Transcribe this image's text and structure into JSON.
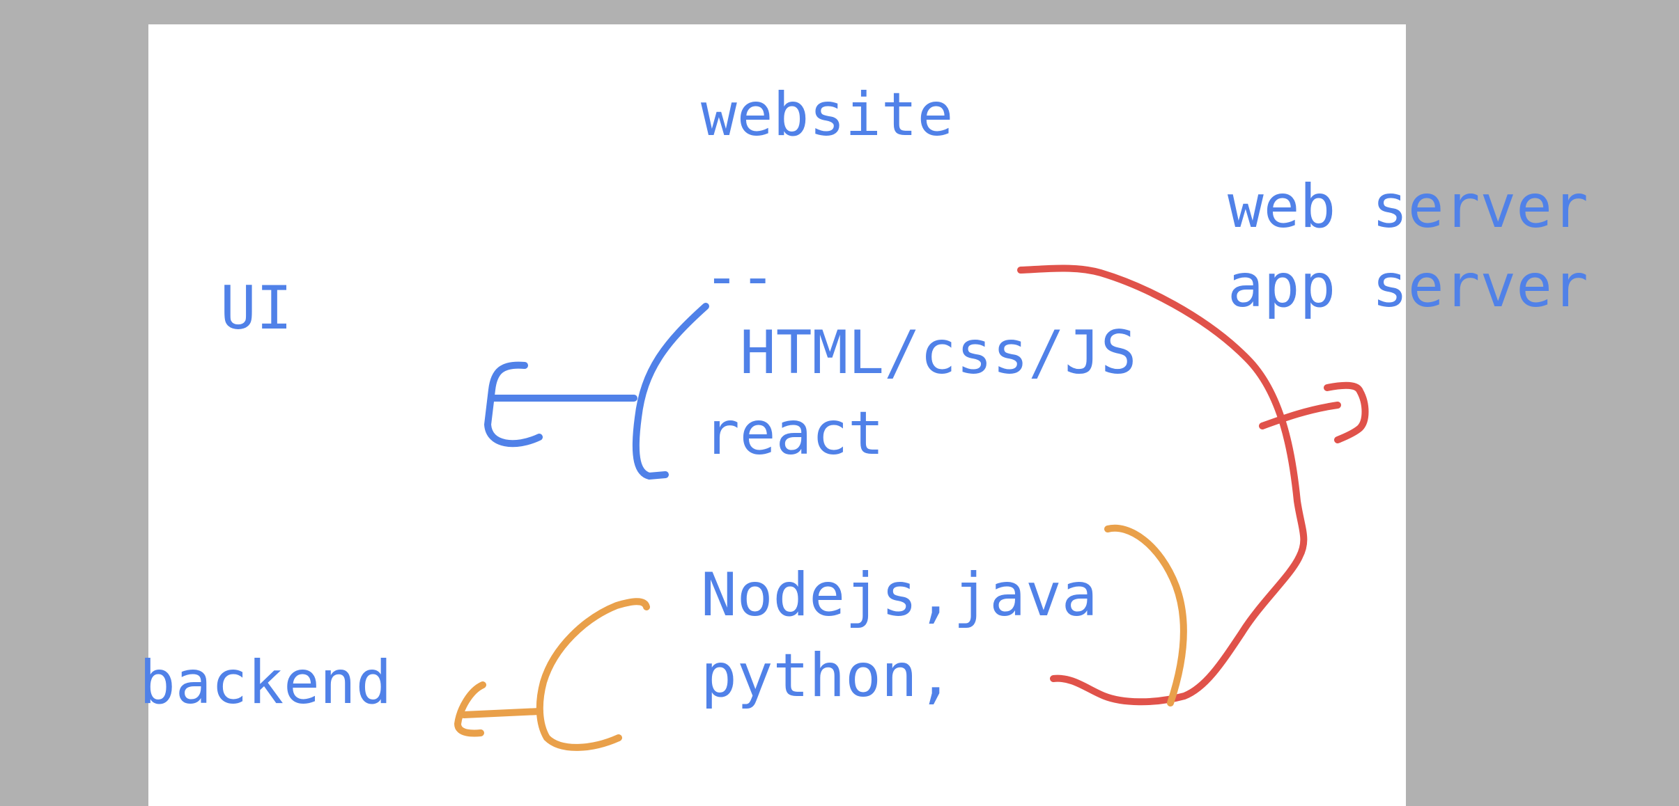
{
  "canvas": {
    "background": "#b1b1b1",
    "page_color": "#ffffff"
  },
  "colors": {
    "text": "#5081e8",
    "blue_stroke": "#5081e8",
    "red_stroke": "#e0524a",
    "orange_stroke": "#e9a04a"
  },
  "notes": {
    "title": "website",
    "ui_label": "UI",
    "dashes": "--",
    "frontend_line1": "HTML/css/JS",
    "frontend_line2": "react",
    "server_line1": "web server",
    "server_line2": "app server",
    "backend_line1": "Nodejs,java",
    "backend_line2": "python,",
    "backend_label": "backend"
  },
  "icons": {
    "ui_arrow": "left-arrow-icon",
    "ui_brace": "left-brace-icon",
    "server_arrow": "right-arrow-icon",
    "backend_arrow": "left-arrow-icon",
    "backend_brace": "left-brace-icon"
  }
}
